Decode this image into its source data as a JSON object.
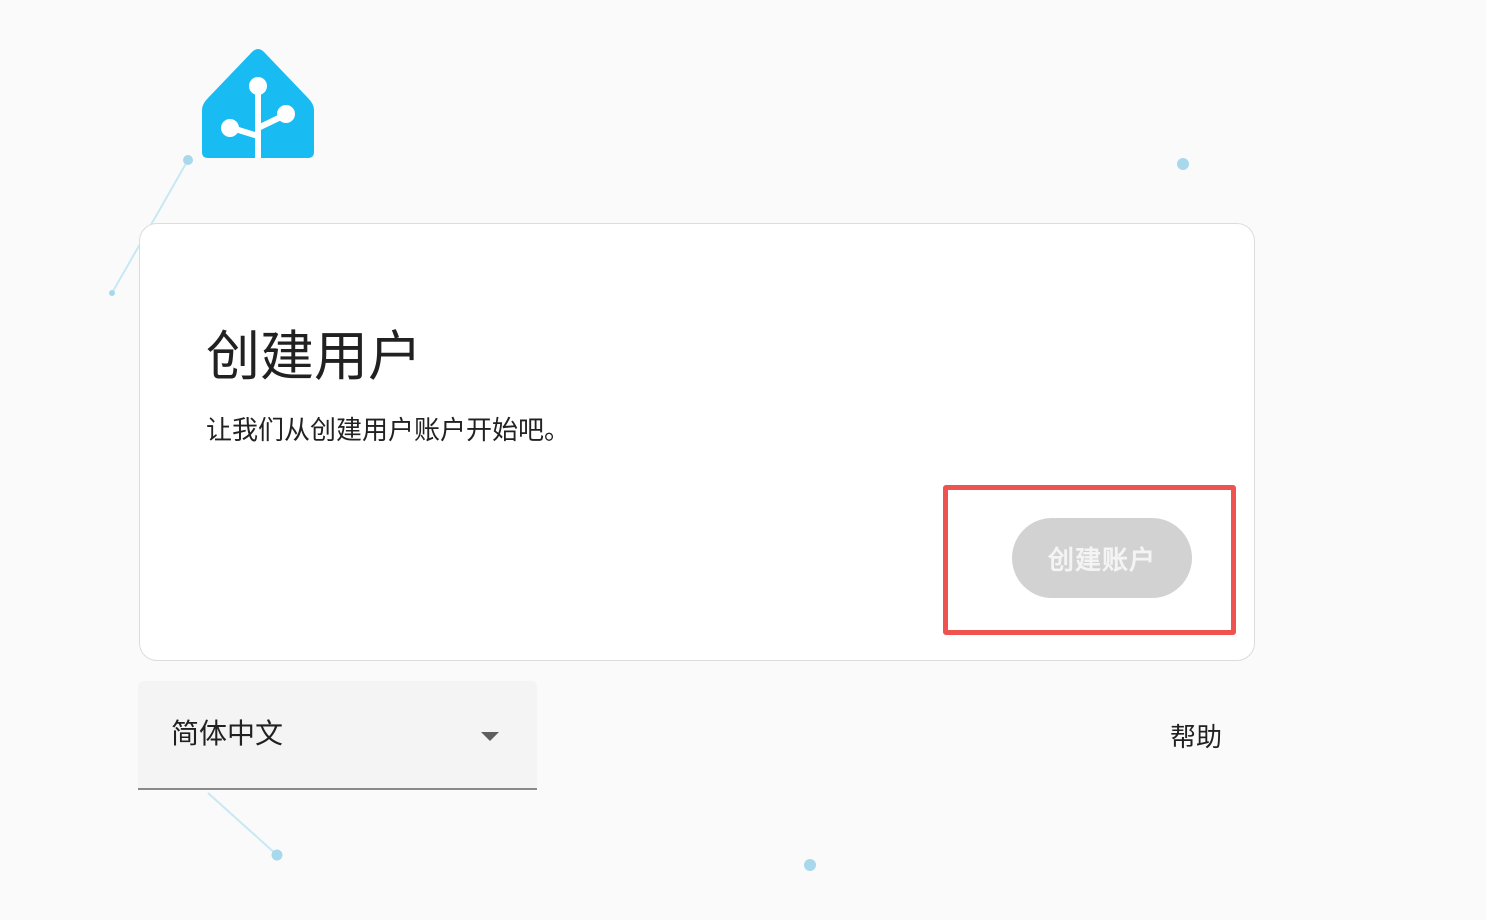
{
  "page": {
    "title": "创建用户",
    "subtitle": "让我们从创建用户账户开始吧。"
  },
  "actions": {
    "create_account_label": "创建账户",
    "create_account_disabled": true
  },
  "footer": {
    "language_selected": "简体中文",
    "help_label": "帮助"
  },
  "brand": {
    "logo_icon": "home-assistant-logo-icon",
    "logo_color": "#18bcf2"
  },
  "colors": {
    "background": "#fafafa",
    "card": "#ffffff",
    "button_disabled": "#d2d2d2",
    "highlight": "#ef5350",
    "decor_dot": "#a8d8ec"
  }
}
